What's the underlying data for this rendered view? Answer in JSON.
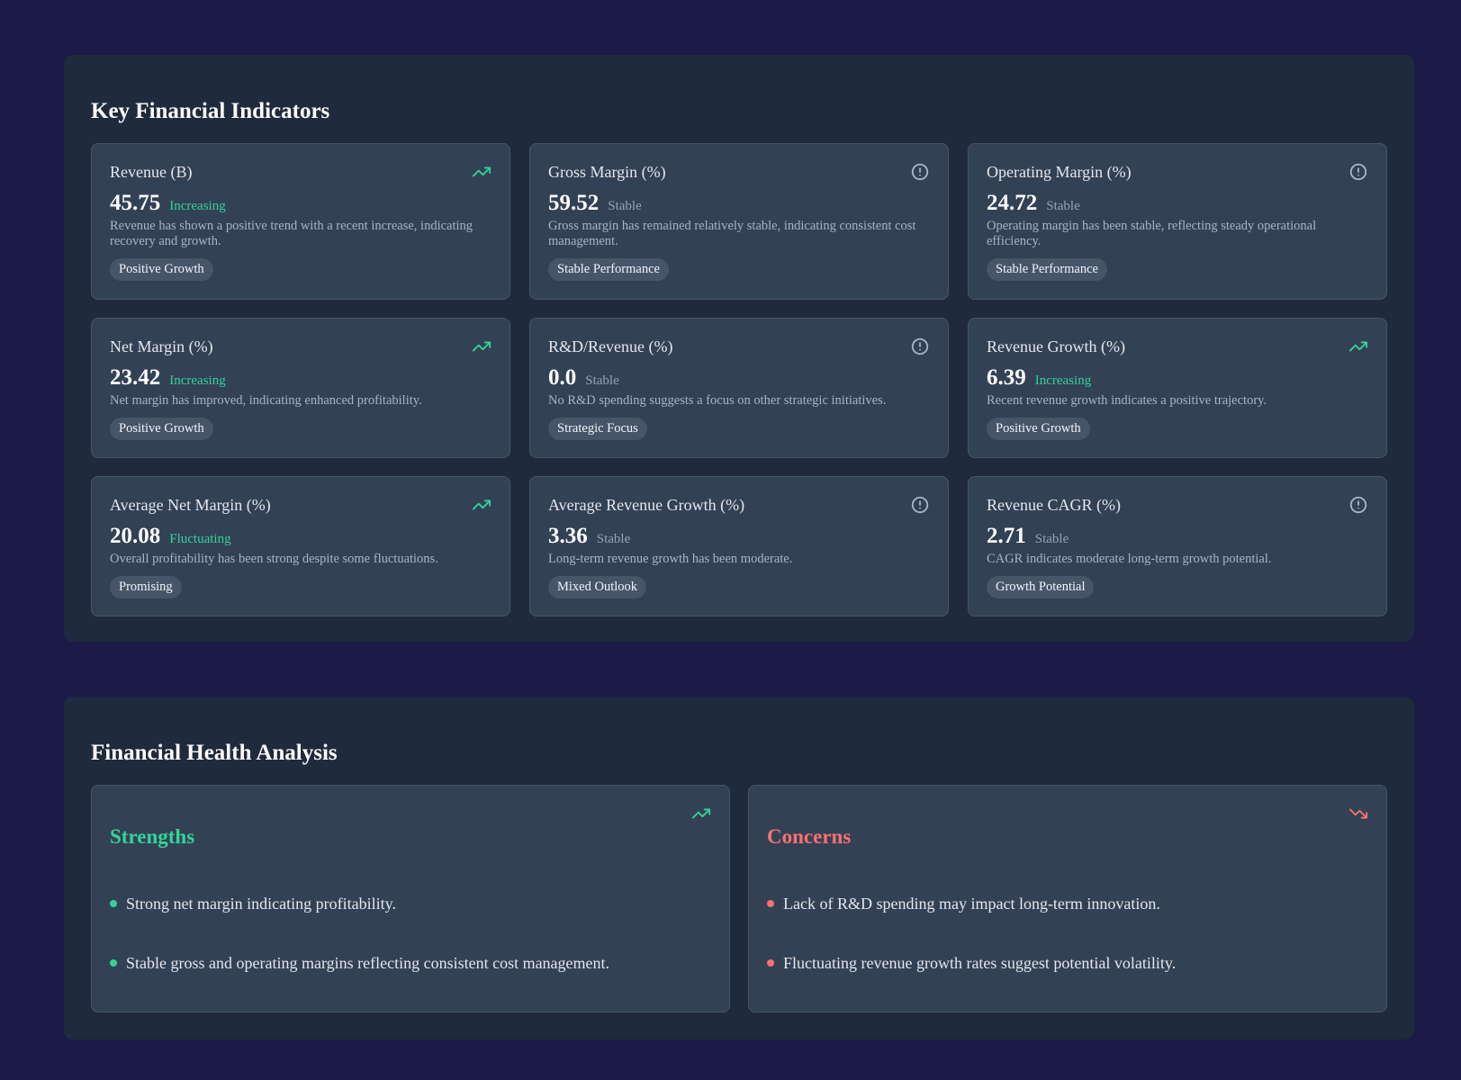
{
  "kpi_section": {
    "title": "Key Financial Indicators",
    "cards": [
      {
        "title": "Revenue (B)",
        "value": "45.75",
        "trend": "Increasing",
        "trend_type": "up",
        "icon": "trending-up-icon",
        "description": "Revenue has shown a positive trend with a recent increase, indicating recovery and growth.",
        "tag": "Positive Growth"
      },
      {
        "title": "Gross Margin (%)",
        "value": "59.52",
        "trend": "Stable",
        "trend_type": "neutral",
        "icon": "alert-circle-icon",
        "description": "Gross margin has remained relatively stable, indicating consistent cost management.",
        "tag": "Stable Performance"
      },
      {
        "title": "Operating Margin (%)",
        "value": "24.72",
        "trend": "Stable",
        "trend_type": "neutral",
        "icon": "alert-circle-icon",
        "description": "Operating margin has been stable, reflecting steady operational efficiency.",
        "tag": "Stable Performance"
      },
      {
        "title": "Net Margin (%)",
        "value": "23.42",
        "trend": "Increasing",
        "trend_type": "up",
        "icon": "trending-up-icon",
        "description": "Net margin has improved, indicating enhanced profitability.",
        "tag": "Positive Growth"
      },
      {
        "title": "R&D/Revenue (%)",
        "value": "0.0",
        "trend": "Stable",
        "trend_type": "neutral",
        "icon": "alert-circle-icon",
        "description": "No R&D spending suggests a focus on other strategic initiatives.",
        "tag": "Strategic Focus"
      },
      {
        "title": "Revenue Growth (%)",
        "value": "6.39",
        "trend": "Increasing",
        "trend_type": "up",
        "icon": "trending-up-icon",
        "description": "Recent revenue growth indicates a positive trajectory.",
        "tag": "Positive Growth"
      },
      {
        "title": "Average Net Margin (%)",
        "value": "20.08",
        "trend": "Fluctuating",
        "trend_type": "up",
        "icon": "trending-up-icon",
        "description": "Overall profitability has been strong despite some fluctuations.",
        "tag": "Promising"
      },
      {
        "title": "Average Revenue Growth (%)",
        "value": "3.36",
        "trend": "Stable",
        "trend_type": "neutral",
        "icon": "alert-circle-icon",
        "description": "Long-term revenue growth has been moderate.",
        "tag": "Mixed Outlook"
      },
      {
        "title": "Revenue CAGR (%)",
        "value": "2.71",
        "trend": "Stable",
        "trend_type": "neutral",
        "icon": "alert-circle-icon",
        "description": "CAGR indicates moderate long-term growth potential.",
        "tag": "Growth Potential"
      }
    ]
  },
  "health_section": {
    "title": "Financial Health Analysis",
    "strengths": {
      "title": "Strengths",
      "icon": "trending-up-icon",
      "items": [
        "Strong net margin indicating profitability.",
        "Stable gross and operating margins reflecting consistent cost management."
      ]
    },
    "concerns": {
      "title": "Concerns",
      "icon": "trending-down-icon",
      "items": [
        "Lack of R&D spending may impact long-term innovation.",
        "Fluctuating revenue growth rates suggest potential volatility."
      ]
    }
  },
  "colors": {
    "page_bg": "#1c1b47",
    "section_bg": "#1f2a3c",
    "card_bg": "#334155",
    "positive": "#34d399",
    "negative": "#f87171",
    "neutral": "#94a3b8"
  }
}
